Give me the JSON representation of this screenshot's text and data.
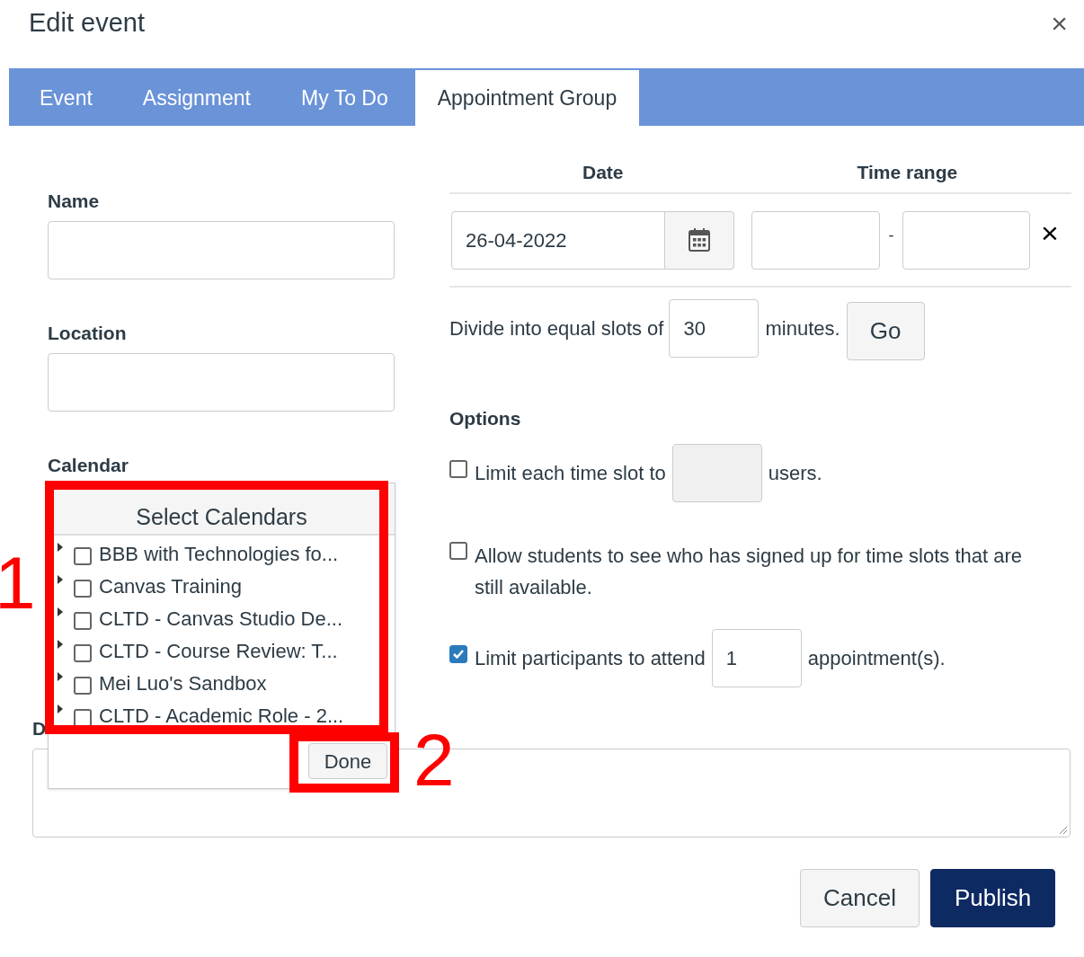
{
  "dialog": {
    "title": "Edit event",
    "close": "×"
  },
  "tabs": [
    {
      "label": "Event",
      "selected": false
    },
    {
      "label": "Assignment",
      "selected": false
    },
    {
      "label": "My To Do",
      "selected": false
    },
    {
      "label": "Appointment Group",
      "selected": true
    }
  ],
  "name": {
    "label": "Name"
  },
  "location": {
    "label": "Location"
  },
  "calendar": {
    "label": "Calendar"
  },
  "slots_table": {
    "columns": [
      "Date",
      "Time range"
    ],
    "date": "26-04-2022",
    "separator": "-",
    "remove": "×"
  },
  "divide": {
    "before": "Divide into equal slots of",
    "value": "30",
    "after": "minutes.",
    "button": "Go"
  },
  "options": {
    "label": "Options",
    "items": [
      {
        "kind": "input",
        "text": "Limit each time slot to",
        "checked": false,
        "value_disabled": true,
        "after": "users."
      },
      {
        "kind": "plain",
        "text": "Allow students to see who has signed up for time slots that are still available.",
        "checked": false
      },
      {
        "kind": "input",
        "text": "Limit participants to attend",
        "checked": true,
        "value": "1",
        "value_disabled": false,
        "after": "appointment(s)."
      }
    ]
  },
  "description": {
    "label": "D"
  },
  "calendar_popup": {
    "title": "Select Calendars",
    "items": [
      {
        "label": "BBB with Technologies fo...",
        "checked": false
      },
      {
        "label": "Canvas Training",
        "checked": false
      },
      {
        "label": "CLTD - Canvas Studio De...",
        "checked": false
      },
      {
        "label": "CLTD - Course Review: T...",
        "checked": false
      },
      {
        "label": "Mei Luo's Sandbox",
        "checked": false
      },
      {
        "label": "CLTD - Academic Role - 2...",
        "checked": false
      }
    ],
    "done": "Done"
  },
  "annotations": [
    "1",
    "2"
  ],
  "buttons": [
    {
      "label": "Cancel",
      "kind": "secondary"
    },
    {
      "label": "Publish",
      "kind": "primary"
    }
  ]
}
